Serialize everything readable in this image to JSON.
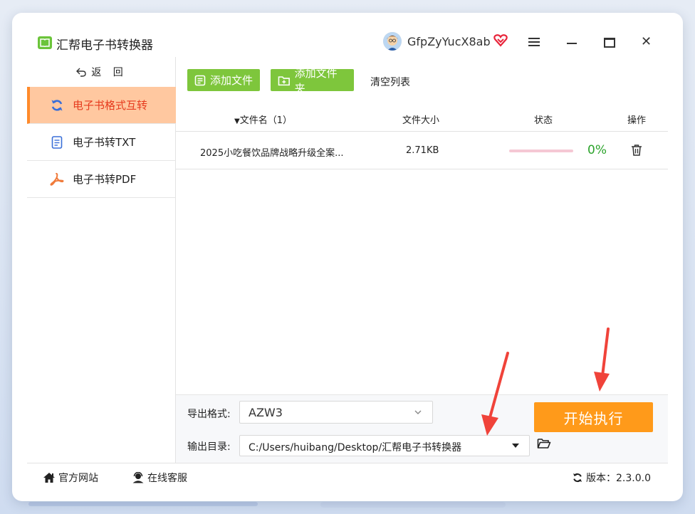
{
  "app": {
    "title": "汇帮电子书转换器",
    "username": "GfpZyYucX8ab"
  },
  "sidebar": {
    "back_label": "返 回",
    "items": [
      {
        "label": "电子书格式互转",
        "active": true
      },
      {
        "label": "电子书转TXT",
        "active": false
      },
      {
        "label": "电子书转PDF",
        "active": false
      }
    ]
  },
  "toolbar": {
    "add_file": "添加文件",
    "add_folder": "添加文件夹",
    "clear_list": "清空列表"
  },
  "table": {
    "columns": [
      "文件名（1）",
      "文件大小",
      "状态",
      "操作"
    ],
    "rows": [
      {
        "name": "2025小吃餐饮品牌战略升级全案...",
        "size": "2.71KB",
        "progress": 0,
        "status": "0%"
      }
    ]
  },
  "bottom": {
    "format_label": "导出格式:",
    "format_value": "AZW3",
    "dir_label": "输出目录:",
    "dir_value": "C:/Users/huibang/Desktop/汇帮电子书转换器",
    "start_label": "开始执行"
  },
  "footer": {
    "website": "官方网站",
    "support": "在线客服",
    "version": "版本：2.3.0.0"
  },
  "colors": {
    "accent_green": "#7ec63c",
    "accent_orange": "#ff9a1a",
    "active_nav_bg": "#ffc8a0",
    "active_nav_text": "#e63b1e",
    "status_green": "#2ba32b",
    "arrow_red": "#f0433a"
  }
}
